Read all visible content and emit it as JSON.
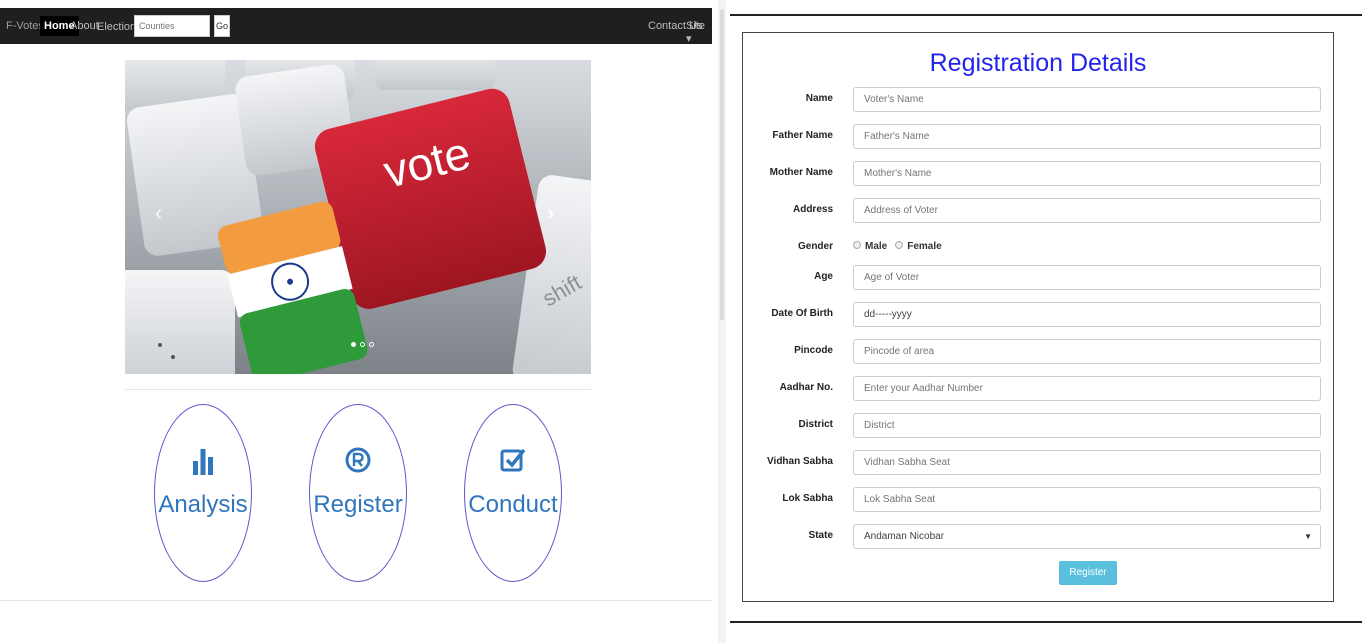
{
  "navbar": {
    "brand": "F-Votes",
    "items": [
      "Home",
      "About",
      "Election ▾"
    ],
    "search_placeholder": "Counties",
    "go_label": "Go",
    "contact_label": "Contact Us",
    "site_label": "Site ▾"
  },
  "carousel": {
    "key_text": "vote",
    "shift_text": "shift",
    "prev_icon": "chevron-left-icon",
    "next_icon": "chevron-right-icon",
    "slides": 3,
    "active_slide": 1
  },
  "features": [
    {
      "label": "Analysis",
      "icon": "bar-chart-icon"
    },
    {
      "label": "Register",
      "icon": "registered-icon"
    },
    {
      "label": "Conduct",
      "icon": "check-square-icon"
    }
  ],
  "form": {
    "title": "Registration Details",
    "fields": [
      {
        "label": "Name",
        "placeholder": "Voter's Name"
      },
      {
        "label": "Father Name",
        "placeholder": "Father's Name"
      },
      {
        "label": "Mother Name",
        "placeholder": "Mother's Name"
      },
      {
        "label": "Address",
        "placeholder": "Address of Voter"
      },
      {
        "label": "Gender"
      },
      {
        "label": "Age",
        "placeholder": "Age of Voter"
      },
      {
        "label": "Date Of Birth",
        "placeholder": "dd-----yyyy"
      },
      {
        "label": "Pincode",
        "placeholder": "Pincode of area"
      },
      {
        "label": "Aadhar No.",
        "placeholder": "Enter your Aadhar Number"
      },
      {
        "label": "District",
        "placeholder": "District"
      },
      {
        "label": "Vidhan Sabha",
        "placeholder": "Vidhan Sabha Seat"
      },
      {
        "label": "Lok Sabha",
        "placeholder": "Lok Sabha Seat"
      },
      {
        "label": "State",
        "value": "Andaman Nicobar"
      }
    ],
    "gender_options": [
      "Male",
      "Female"
    ],
    "submit_label": "Register"
  },
  "colors": {
    "accent": "#2323ee",
    "button": "#5bc0de",
    "feature_text": "#2f76bd",
    "vote_key": "#c8202f",
    "flag_saffron": "#f29b3f",
    "flag_green": "#2e9a3a"
  }
}
